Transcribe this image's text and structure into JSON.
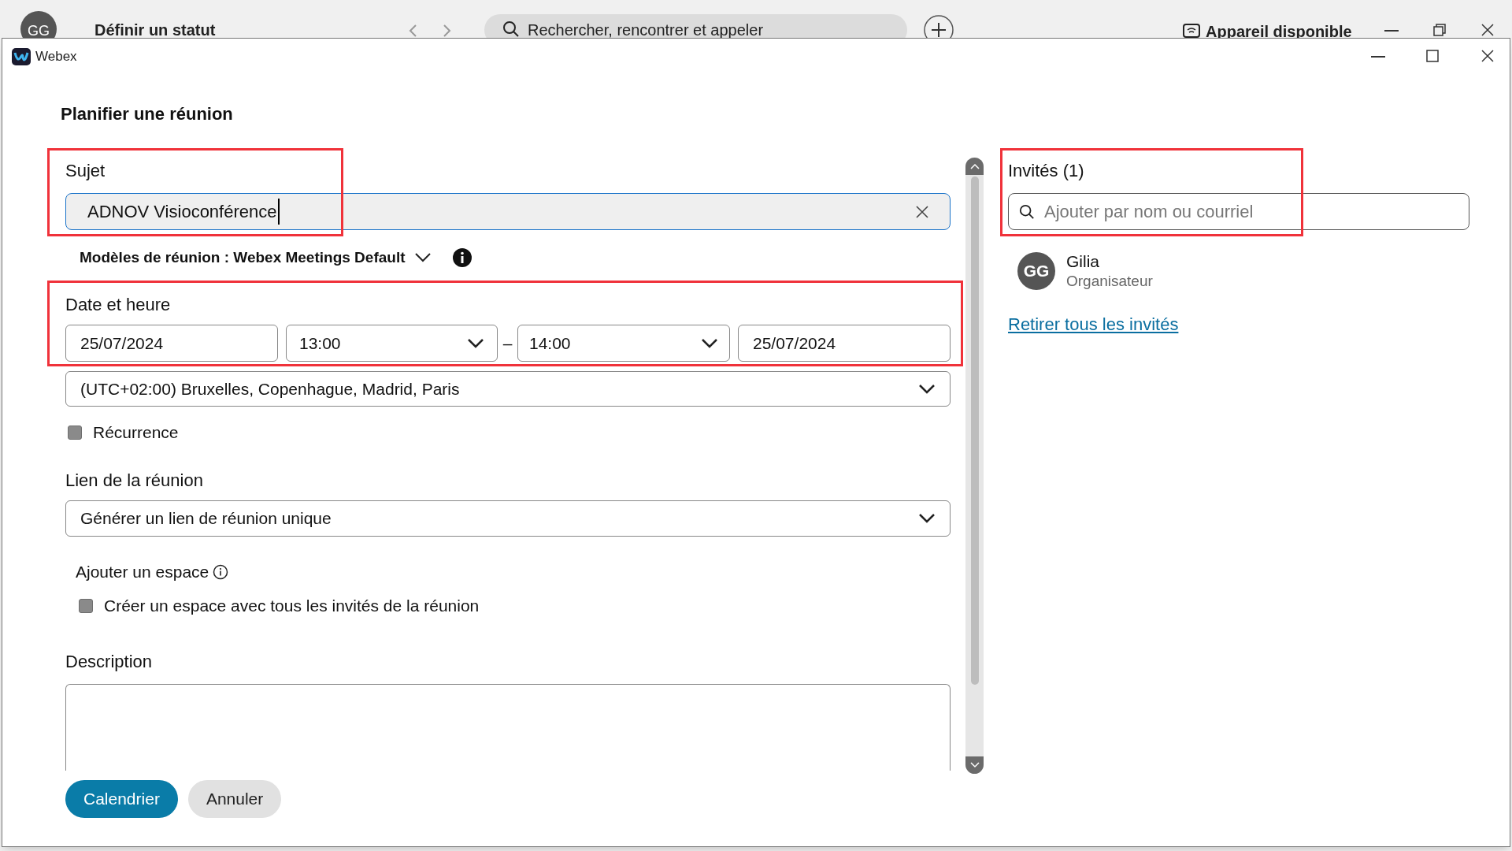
{
  "background_app": {
    "avatar_initials": "GG",
    "status": "Définir un statut",
    "search_placeholder": "Rechercher, rencontrer et appeler",
    "device": "Appareil disponible"
  },
  "window": {
    "title": "Webex"
  },
  "heading": "Planifier une réunion",
  "subject": {
    "label": "Sujet",
    "value": "ADNOV Visioconférence"
  },
  "template": {
    "label": "Modèles de réunion : Webex Meetings Default"
  },
  "datetime": {
    "label": "Date et heure",
    "start_date": "25/07/2024",
    "start_time": "13:00",
    "separator": "–",
    "end_time": "14:00",
    "end_date": "25/07/2024",
    "timezone": "(UTC+02:00) Bruxelles, Copenhague, Madrid, Paris"
  },
  "recurrence": {
    "label": "Récurrence",
    "checked": false
  },
  "meeting_link": {
    "label": "Lien de la réunion",
    "value": "Générer un lien de réunion unique"
  },
  "space": {
    "label": "Ajouter un espace",
    "option": "Créer un espace avec tous les invités de la réunion",
    "checked": false
  },
  "description": {
    "label": "Description"
  },
  "buttons": [
    {
      "label": "Calendrier",
      "kind": "primary"
    },
    {
      "label": "Annuler",
      "kind": "secondary"
    }
  ],
  "invitees": {
    "label": "Invités (1)",
    "placeholder": "Ajouter par nom ou courriel",
    "people": [
      {
        "initials": "GG",
        "name": "Gilia",
        "role": "Organisateur"
      }
    ],
    "remove_all": "Retirer tous les invités"
  }
}
